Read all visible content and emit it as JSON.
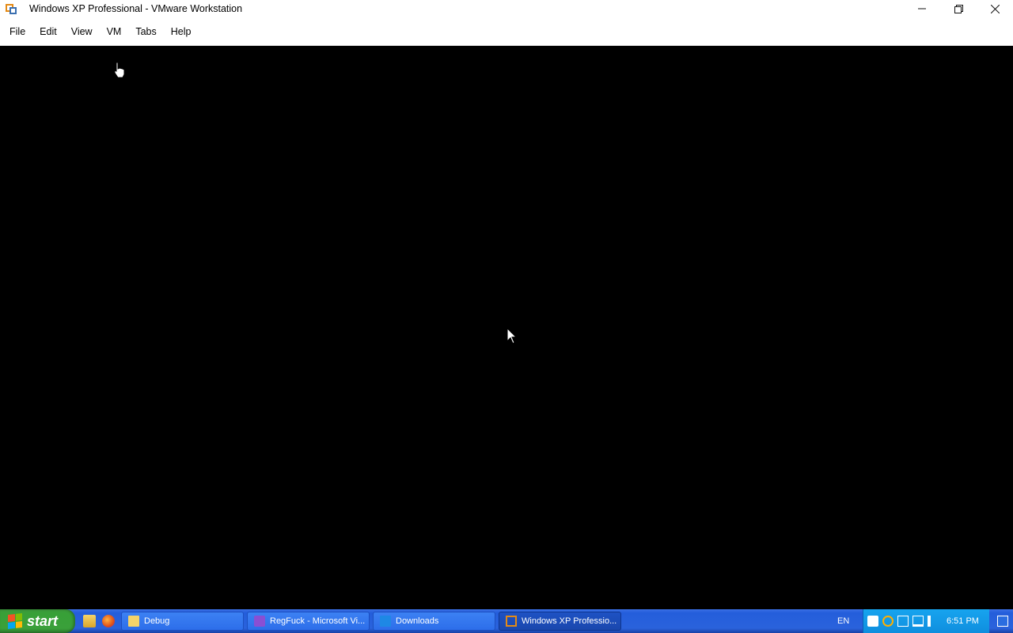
{
  "window": {
    "title": "Windows XP Professional - VMware Workstation",
    "icon": "vmware-icon"
  },
  "controls": {
    "minimize": "minimize-icon",
    "maximize": "restore-icon",
    "close": "close-icon"
  },
  "menu": {
    "file": "File",
    "edit": "Edit",
    "view": "View",
    "vm": "VM",
    "tabs": "Tabs",
    "help": "Help"
  },
  "taskbar": {
    "start_label": "start",
    "quick_launch": [
      "file-explorer-icon",
      "firefox-icon"
    ],
    "tasks": [
      {
        "label": "Debug",
        "icon": "folder-icon"
      },
      {
        "label": "RegFuck - Microsoft Vi...",
        "icon": "visual-studio-icon"
      },
      {
        "label": "Downloads",
        "icon": "download-folder-icon"
      },
      {
        "label": "Windows XP Professio...",
        "icon": "vmware-icon",
        "active": true
      }
    ],
    "language": "EN",
    "clock": "6:51 PM"
  },
  "colors": {
    "taskbar_blue": "#245edb",
    "start_green": "#3aa03a",
    "tray_blue": "#0f8ede",
    "vm_background": "#000000"
  }
}
